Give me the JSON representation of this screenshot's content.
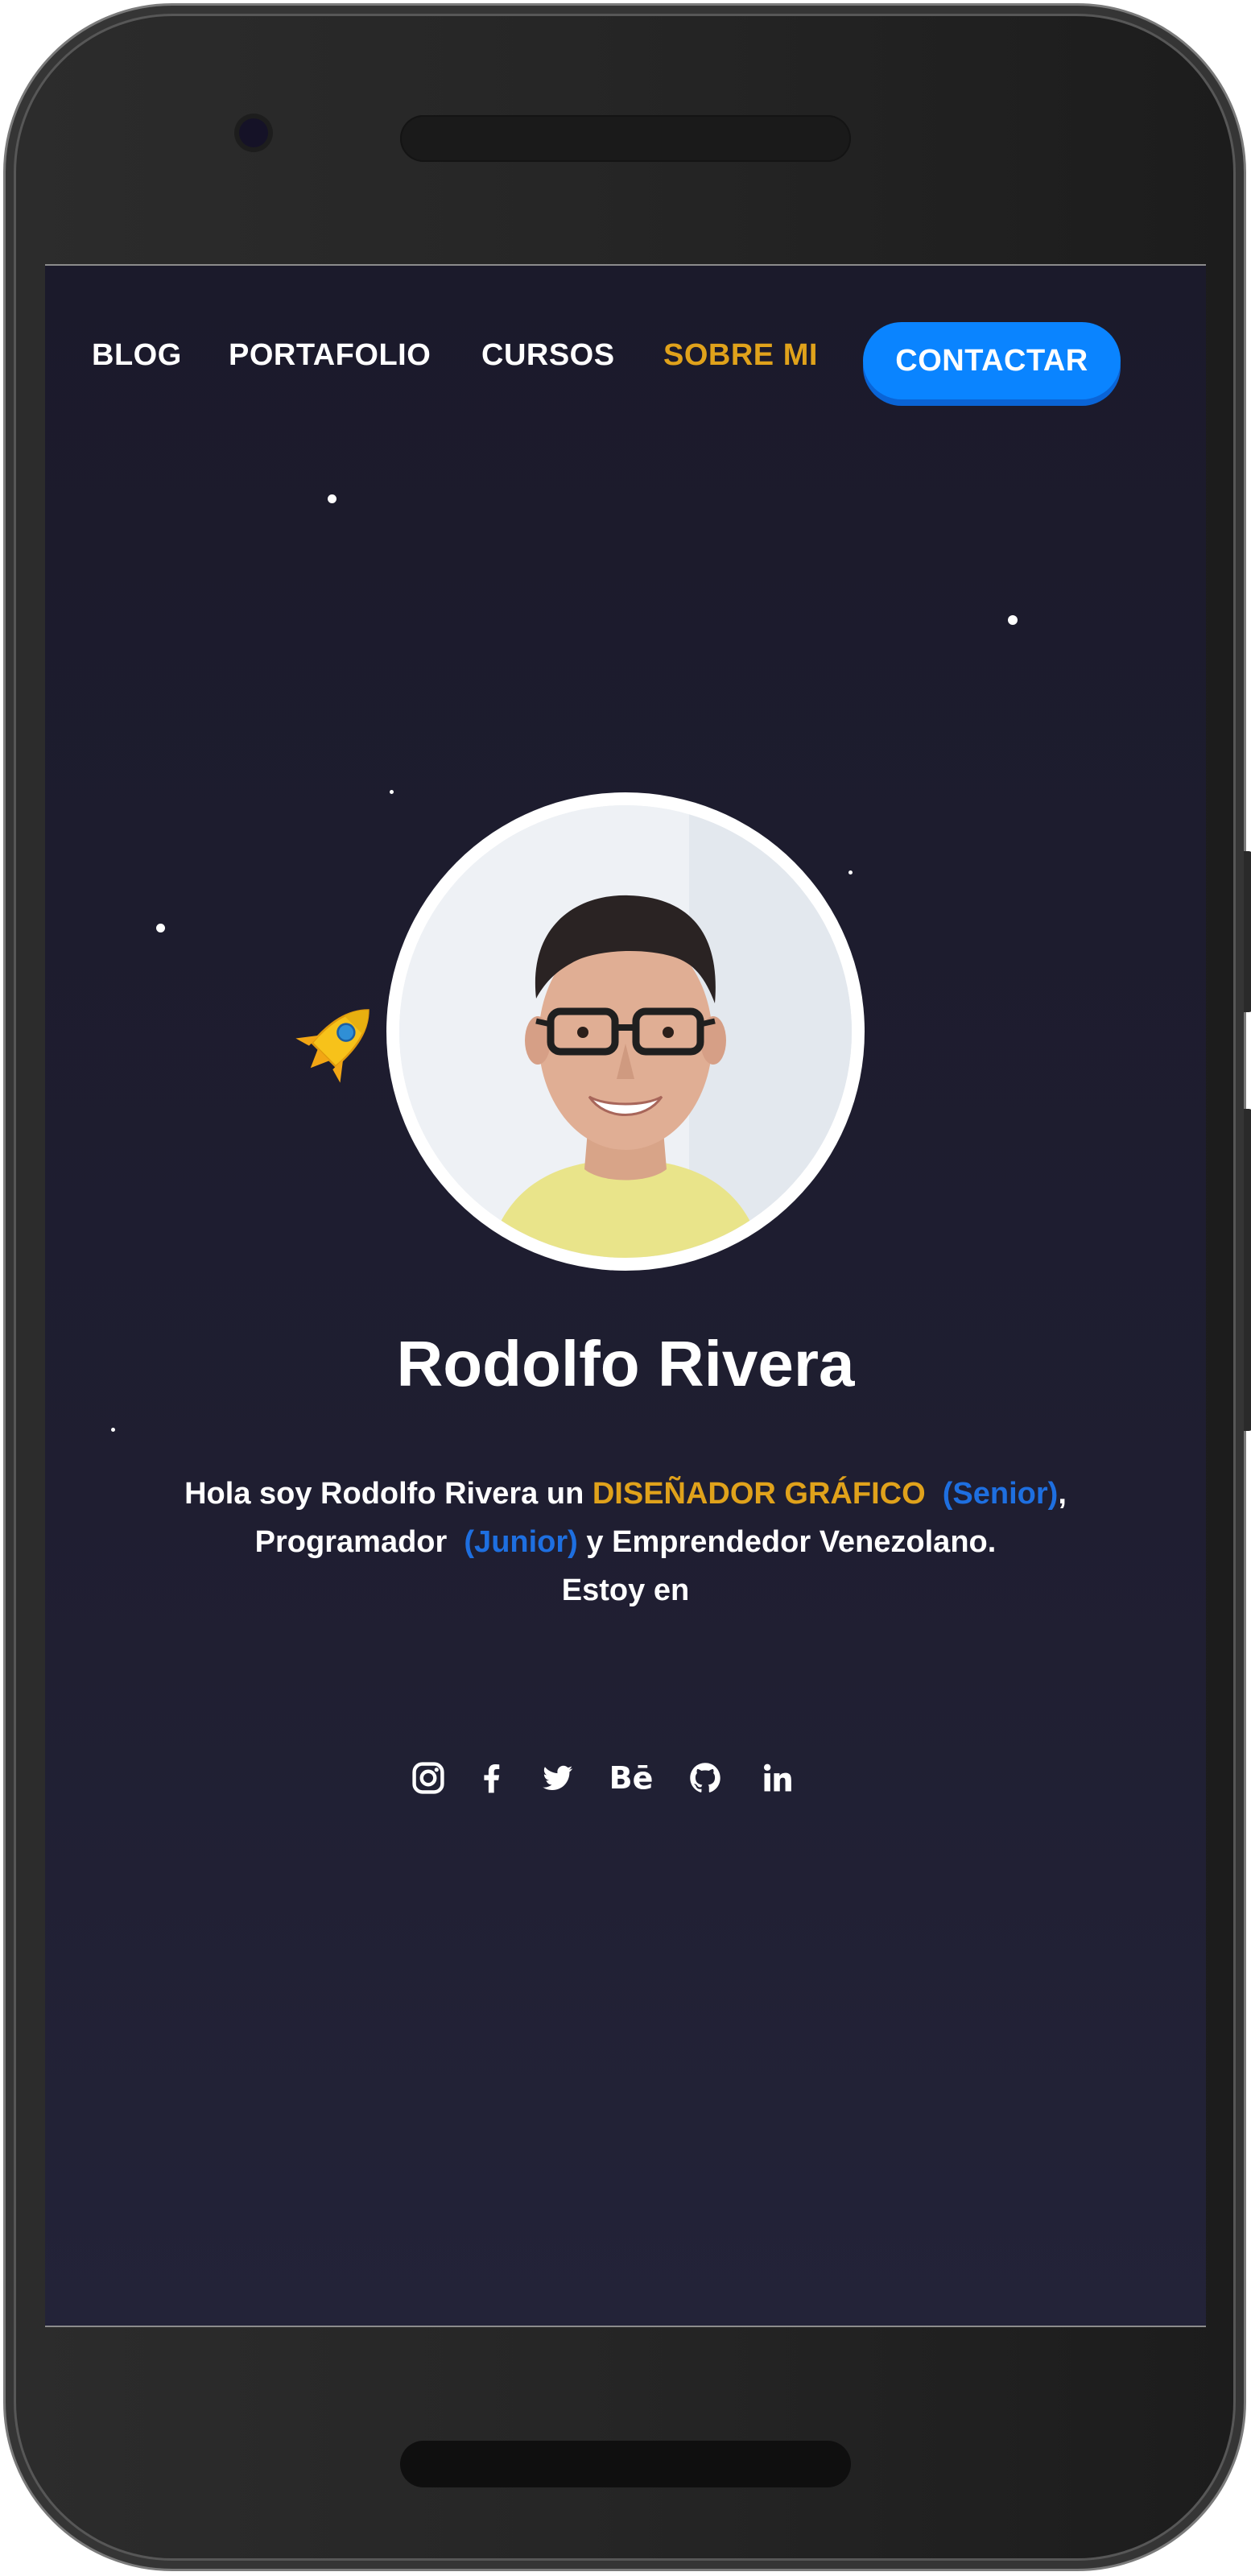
{
  "nav": {
    "items": [
      {
        "label": "BLOG"
      },
      {
        "label": "PORTAFOLIO"
      },
      {
        "label": "CURSOS"
      },
      {
        "label": "SOBRE MI"
      }
    ],
    "active_index": 3,
    "contact_label": "CONTACTAR"
  },
  "hero": {
    "name": "Rodolfo Rivera",
    "intro": {
      "part1": "Hola soy Rodolfo Rivera un ",
      "role1": "DISEÑADOR GRÁFICO",
      "level1": "(Senior)",
      "comma": ",",
      "part2": "Programador ",
      "level2": "(Junior)",
      "part3": " y Emprendedor Venezolano.",
      "line3": "Estoy en"
    }
  },
  "social": {
    "icons": [
      "instagram-icon",
      "facebook-icon",
      "twitter-icon",
      "behance-icon",
      "github-icon",
      "linkedin-icon"
    ],
    "behance_text": "Bē"
  },
  "colors": {
    "background": "#1b1a2b",
    "accent_gold": "#e0a21b",
    "accent_blue": "#1e6fe0",
    "button_blue": "#0a84ff"
  }
}
